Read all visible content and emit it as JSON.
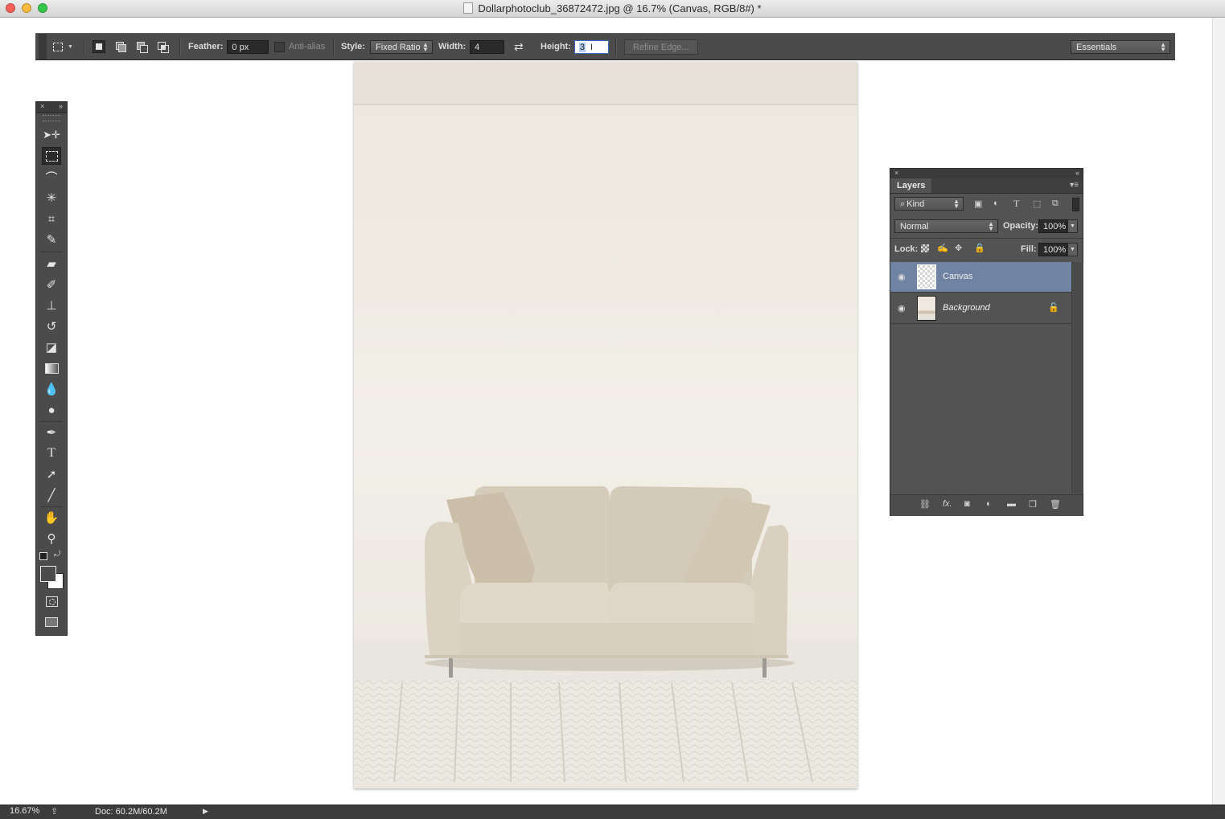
{
  "window": {
    "title": "Dollarphotoclub_36872472.jpg @ 16.7% (Canvas, RGB/8#) *"
  },
  "options_bar": {
    "feather_label": "Feather:",
    "feather_value": "0 px",
    "antialias_label": "Anti-alias",
    "style_label": "Style:",
    "style_value": "Fixed Ratio",
    "width_label": "Width:",
    "width_value": "4",
    "height_label": "Height:",
    "height_value": "3",
    "refine_edge_label": "Refine Edge...",
    "workspace_value": "Essentials"
  },
  "toolbox": {
    "selected_tool": "rectangular-marquee",
    "tools": [
      "move",
      "rectangular-marquee",
      "lasso",
      "quick-selection",
      "crop",
      "eyedropper",
      "spot-healing",
      "brush",
      "clone-stamp",
      "history-brush",
      "eraser",
      "gradient",
      "blur",
      "dodge",
      "pen",
      "type",
      "path-selection",
      "line",
      "hand",
      "zoom"
    ]
  },
  "layers_panel": {
    "tab_label": "Layers",
    "filter_value": "Kind",
    "blend_mode": "Normal",
    "opacity_label": "Opacity:",
    "opacity_value": "100%",
    "lock_label": "Lock:",
    "fill_label": "Fill:",
    "fill_value": "100%",
    "layers": [
      {
        "name": "Canvas",
        "selected": true,
        "locked": false
      },
      {
        "name": "Background",
        "selected": false,
        "locked": true
      }
    ]
  },
  "status_bar": {
    "zoom": "16.67%",
    "doc_info": "Doc: 60.2M/60.2M"
  },
  "colors": {
    "panel_bg": "#535353",
    "selected_layer": "#6f83a3",
    "wall": "#efebe3",
    "sofa": "#d8cfbf"
  }
}
